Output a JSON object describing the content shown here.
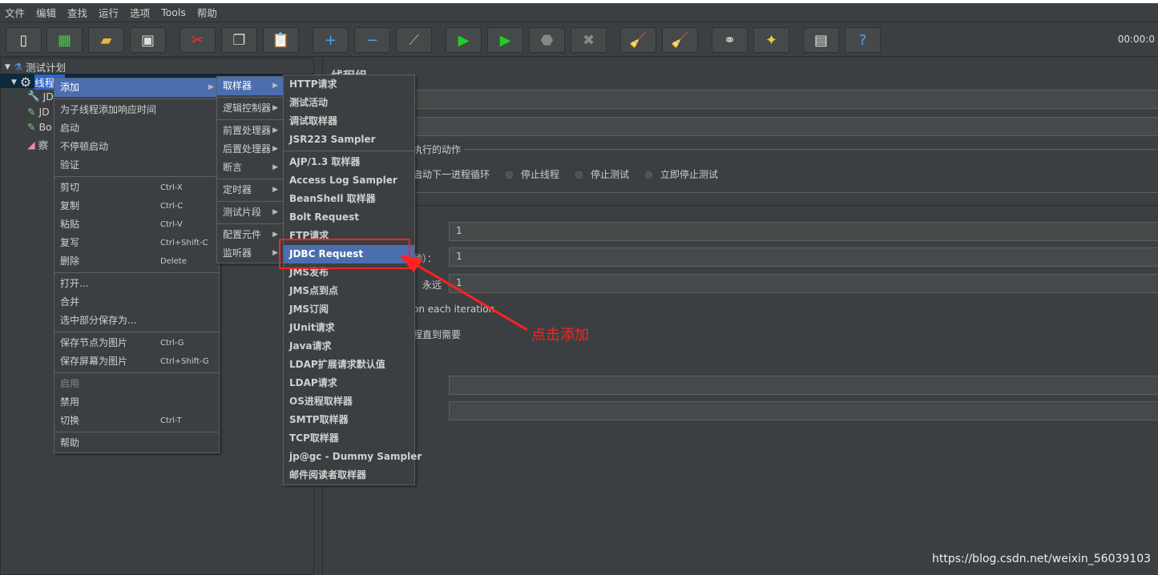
{
  "menubar": [
    "文件",
    "编辑",
    "查找",
    "运行",
    "选项",
    "Tools",
    "帮助"
  ],
  "toolbar": {
    "buttons": [
      "new-icon",
      "templates-icon",
      "open-icon",
      "save-icon",
      "cut-icon",
      "copy-icon",
      "paste-icon",
      "expand-icon",
      "collapse-icon",
      "toggle-icon",
      "start-icon",
      "start-no-pause-icon",
      "stop-icon",
      "shutdown-icon",
      "clear-icon",
      "clear-all-icon",
      "search-icon",
      "reset-search-icon",
      "function-helper-icon",
      "help-icon"
    ],
    "timer": "00:00:0"
  },
  "tree": {
    "root": "测试计划",
    "thread_group": "线程组",
    "children": [
      "JD",
      "JD",
      "Bo",
      "察"
    ]
  },
  "context_menu": {
    "items": [
      {
        "label": "添加",
        "submenu": true,
        "highlighted": true
      },
      {
        "sep": true
      },
      {
        "label": "为子线程添加响应时间"
      },
      {
        "label": "启动"
      },
      {
        "label": "不停顿启动"
      },
      {
        "label": "验证"
      },
      {
        "sep": true
      },
      {
        "label": "剪切",
        "shortcut": "Ctrl-X"
      },
      {
        "label": "复制",
        "shortcut": "Ctrl-C"
      },
      {
        "label": "粘贴",
        "shortcut": "Ctrl-V"
      },
      {
        "label": "复写",
        "shortcut": "Ctrl+Shift-C"
      },
      {
        "label": "删除",
        "shortcut": "Delete"
      },
      {
        "sep": true
      },
      {
        "label": "打开..."
      },
      {
        "label": "合并"
      },
      {
        "label": "选中部分保存为..."
      },
      {
        "sep": true
      },
      {
        "label": "保存节点为图片",
        "shortcut": "Ctrl-G"
      },
      {
        "label": "保存屏幕为图片",
        "shortcut": "Ctrl+Shift-G"
      },
      {
        "sep": true
      },
      {
        "label": "启用",
        "disabled": true
      },
      {
        "label": "禁用"
      },
      {
        "label": "切换",
        "shortcut": "Ctrl-T"
      },
      {
        "sep": true
      },
      {
        "label": "帮助"
      }
    ]
  },
  "add_menu": {
    "items": [
      {
        "label": "取样器",
        "highlighted": true
      },
      {
        "sep": true
      },
      {
        "label": "逻辑控制器"
      },
      {
        "sep": true
      },
      {
        "label": "前置处理器"
      },
      {
        "label": "后置处理器"
      },
      {
        "label": "断言"
      },
      {
        "sep": true
      },
      {
        "label": "定时器"
      },
      {
        "sep": true
      },
      {
        "label": "测试片段"
      },
      {
        "sep": true
      },
      {
        "label": "配置元件"
      },
      {
        "label": "监听器"
      }
    ]
  },
  "sampler_menu": {
    "items": [
      {
        "label": "HTTP请求"
      },
      {
        "label": "测试活动"
      },
      {
        "label": "调试取样器"
      },
      {
        "label": "JSR223 Sampler"
      },
      {
        "sep": true
      },
      {
        "label": "AJP/1.3 取样器"
      },
      {
        "label": "Access Log Sampler"
      },
      {
        "label": "BeanShell 取样器"
      },
      {
        "label": "Bolt Request"
      },
      {
        "label": "FTP请求"
      },
      {
        "label": "JDBC Request",
        "highlighted": true
      },
      {
        "label": "JMS发布"
      },
      {
        "label": "JMS点到点"
      },
      {
        "label": "JMS订阅"
      },
      {
        "label": "JUnit请求"
      },
      {
        "label": "Java请求"
      },
      {
        "label": "LDAP扩展请求默认值"
      },
      {
        "label": "LDAP请求"
      },
      {
        "label": "OS进程取样器"
      },
      {
        "label": "SMTP取样器"
      },
      {
        "label": "TCP取样器"
      },
      {
        "label": "jp@gc - Dummy Sampler"
      },
      {
        "label": "邮件阅读者取样器"
      }
    ]
  },
  "panel": {
    "title": "线程组",
    "action_group": "执行的动作",
    "radios": [
      "启动下一进程循环",
      "停止线程",
      "停止测试",
      "立即停止测试"
    ],
    "threads_value": "1",
    "ramp_label": "秒）：",
    "ramp_value": "1",
    "forever_label": "永远",
    "loop_value": "1",
    "same_user_label": "on each iteration",
    "delay_label": "程直到需要"
  },
  "annotation": {
    "text": "点击添加",
    "color": "#ff2222"
  },
  "watermark": "https://blog.csdn.net/weixin_56039103"
}
